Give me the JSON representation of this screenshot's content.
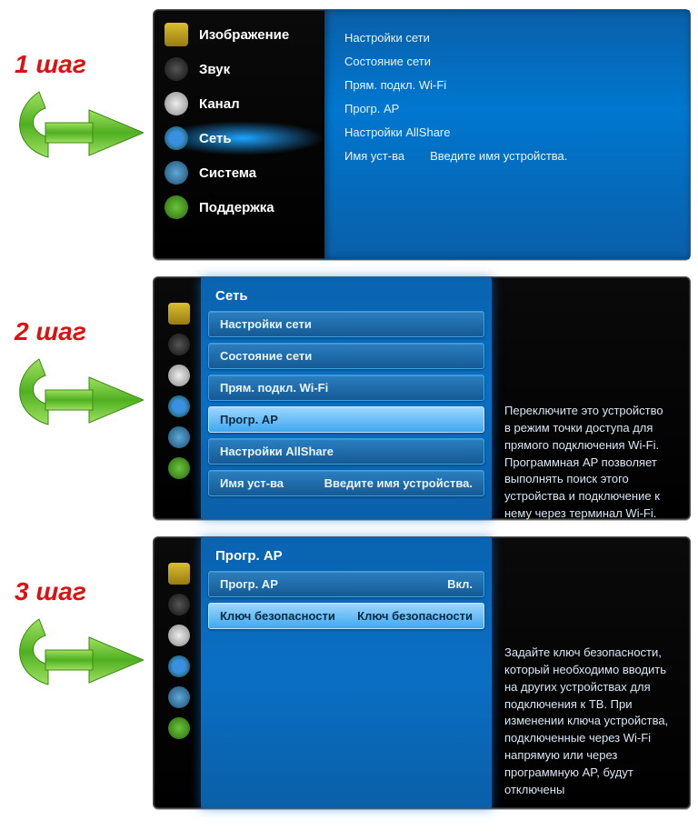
{
  "step_labels": {
    "s1": "1 шаг",
    "s2": "2 шаг",
    "s3": "3 шаг"
  },
  "menu": {
    "picture": "Изображение",
    "sound": "Звук",
    "channel": "Канал",
    "network": "Сеть",
    "system": "Система",
    "support": "Поддержка"
  },
  "panel1": {
    "net_settings": "Настройки сети",
    "net_status": "Состояние сети",
    "wifi_direct": "Прям. подкл. Wi-Fi",
    "soft_ap": "Прогр. AP",
    "allshare": "Настройки AllShare",
    "dev_name_label": "Имя уст-ва",
    "dev_name_value": "Введите имя устройства."
  },
  "panel2": {
    "title": "Сеть",
    "net_settings": "Настройки сети",
    "net_status": "Состояние сети",
    "wifi_direct": "Прям. подкл. Wi-Fi",
    "soft_ap": "Прогр. AP",
    "allshare": "Настройки AllShare",
    "dev_name_label": "Имя уст-ва",
    "dev_name_value": "Введите имя устройства.",
    "desc": "Переключите это устройство в режим точки доступа для прямого подключения Wi-Fi. Программная AP позволяет выполнять поиск этого устройства и подключение к нему через терминал Wi-Fi."
  },
  "panel3": {
    "title": "Прогр. AP",
    "soft_ap_label": "Прогр. AP",
    "soft_ap_value": "Вкл.",
    "sec_key_label": "Ключ безопасности",
    "sec_key_value": "Ключ безопасности",
    "desc": "Задайте ключ безопасности, который необходимо вводить на других устройствах для подключения к ТВ. При изменении ключа устройства, подключенные через Wi-Fi напрямую или через программную AP, будут отключены"
  }
}
